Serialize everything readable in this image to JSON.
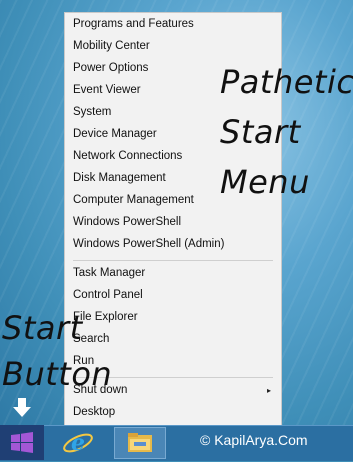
{
  "menu": {
    "items": [
      "Programs and Features",
      "Mobility Center",
      "Power Options",
      "Event Viewer",
      "System",
      "Device Manager",
      "Network Connections",
      "Disk Management",
      "Computer Management",
      "Windows PowerShell",
      "Windows PowerShell (Admin)",
      "Task Manager",
      "Control Panel",
      "File Explorer",
      "Search",
      "Run",
      "Shut down",
      "Desktop"
    ],
    "submenu_arrow": "▸"
  },
  "annotations": {
    "pathetic": "Pathetic",
    "start_word": "Start",
    "menu_word": "Menu",
    "start_button_line1": "Start",
    "start_button_line2": "Button"
  },
  "taskbar": {
    "watermark": "© KapilArya.Com"
  },
  "icons": {
    "start": "windows-logo-icon",
    "ie": "internet-explorer-icon",
    "explorer": "file-explorer-icon",
    "down_arrow": "down-arrow-icon"
  },
  "colors": {
    "menu_bg": "#f2f2f2",
    "taskbar": "#2b6fa2",
    "start_button": "#1f3f74",
    "windows_logo": "#a457d6"
  }
}
